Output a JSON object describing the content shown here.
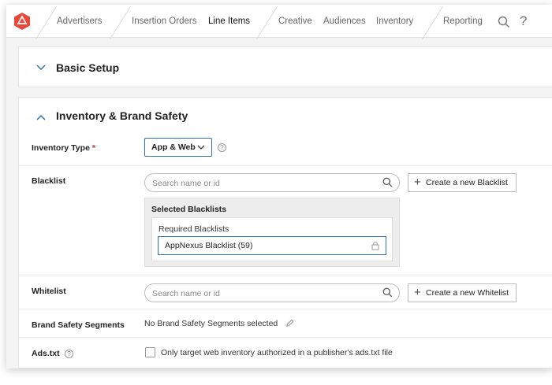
{
  "nav": {
    "items": [
      "Advertisers",
      "Insertion Orders",
      "Line Items",
      "Creative",
      "Audiences",
      "Inventory",
      "Reporting"
    ],
    "active": "Line Items",
    "search_icon": "search-icon",
    "help_glyph": "?"
  },
  "basic_setup": {
    "title": "Basic Setup"
  },
  "inventory": {
    "title": "Inventory & Brand Safety",
    "inventory_type": {
      "label": "Inventory Type",
      "required_mark": "*",
      "value": "App & Web"
    },
    "blacklist": {
      "label": "Blacklist",
      "search_placeholder": "Search name or id",
      "create_label": "Create a new Blacklist",
      "selected_title": "Selected Blacklists",
      "required_title": "Required Blacklists",
      "items": [
        "AppNexus Blacklist (59)"
      ]
    },
    "whitelist": {
      "label": "Whitelist",
      "search_placeholder": "Search name or id",
      "create_label": "Create a new Whitelist"
    },
    "brand_safety": {
      "label": "Brand Safety Segments",
      "value": "No Brand Safety Segments selected"
    },
    "ads_txt": {
      "label": "Ads.txt",
      "checkbox_label": "Only target web inventory authorized in a publisher's ads.txt file",
      "checked": false
    }
  },
  "colors": {
    "accent": "#2d6fb8",
    "logo": "#e8473a",
    "required": "#e03030"
  }
}
